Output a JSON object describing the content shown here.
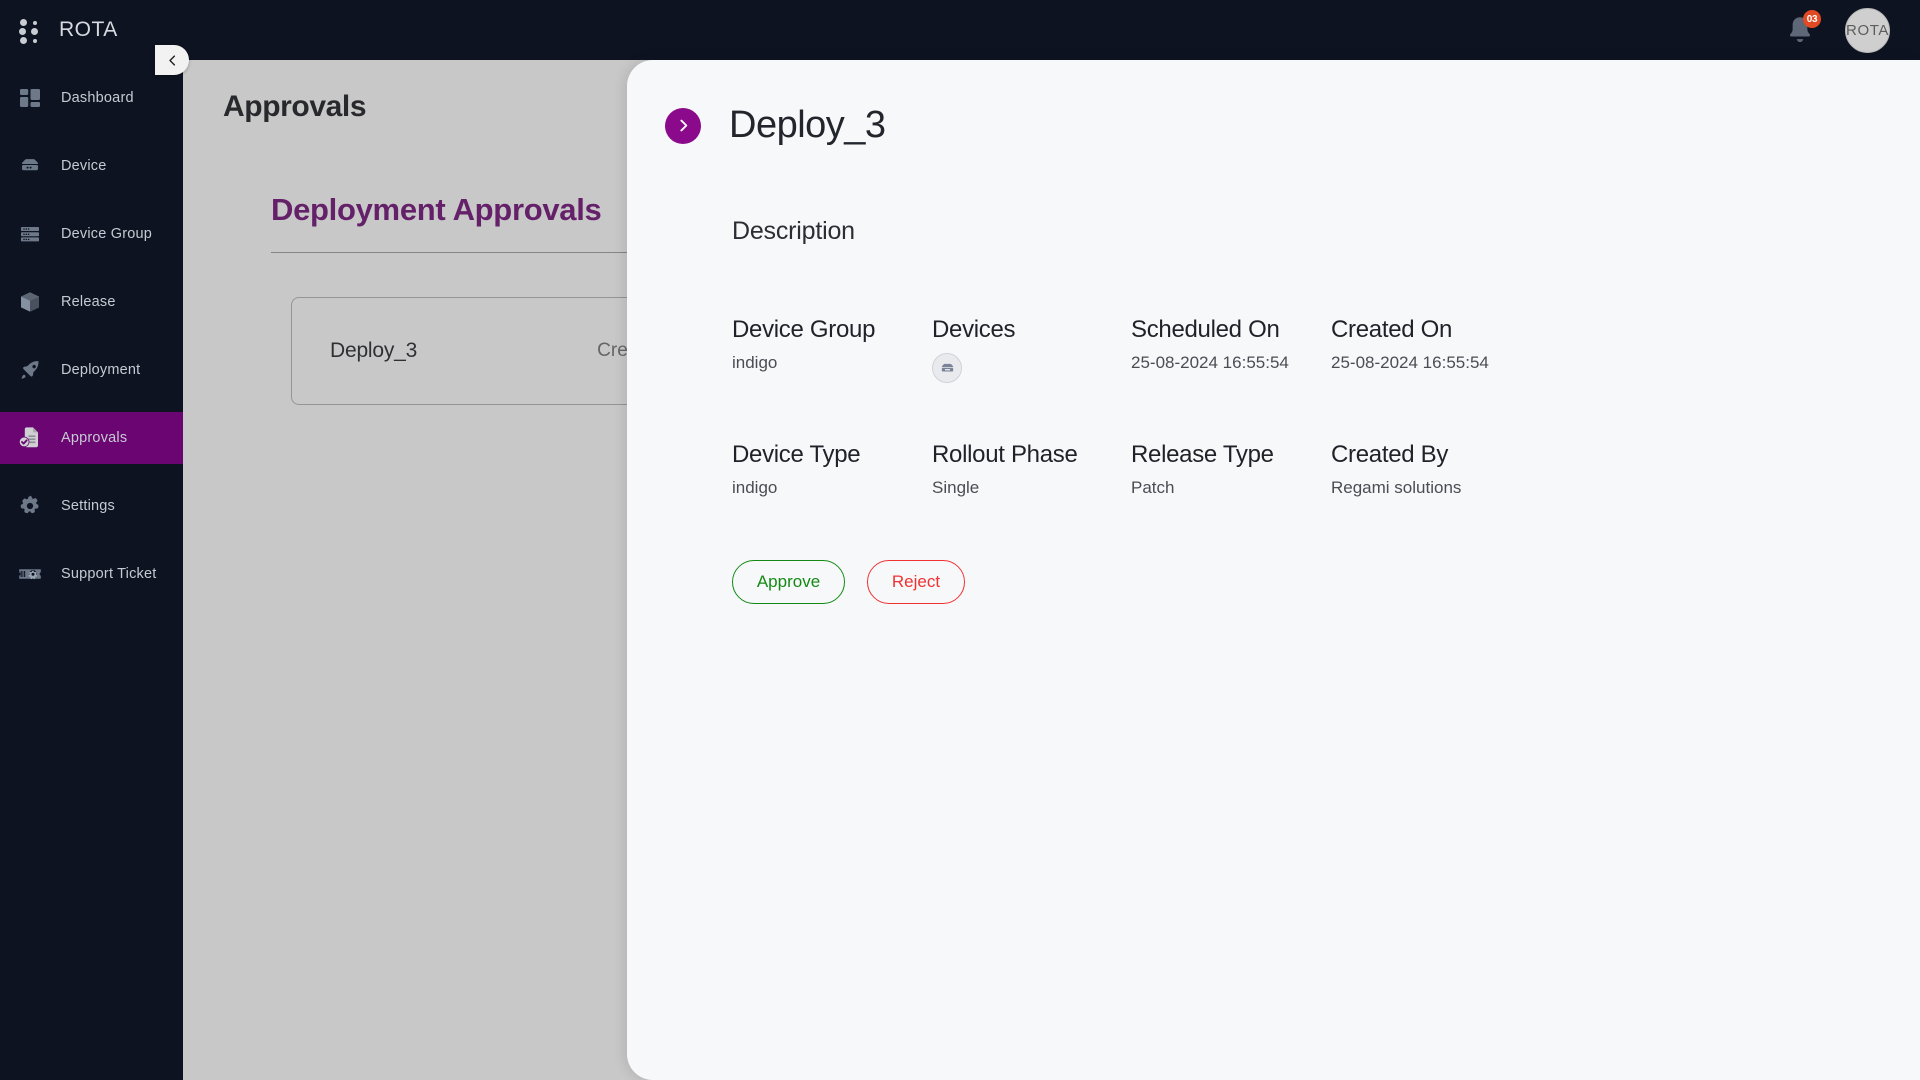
{
  "topbar": {
    "brand": "ROTA",
    "menu_icon": "grid-dots-icon",
    "notification_icon": "bell-icon",
    "notification_count": "03",
    "avatar_text": "ROTA"
  },
  "sidebar": {
    "collapse_icon": "chevron-left-icon",
    "items": [
      {
        "label": "Dashboard",
        "icon": "dashboard-icon",
        "active": false
      },
      {
        "label": "Device",
        "icon": "device-icon",
        "active": false
      },
      {
        "label": "Device Group",
        "icon": "device-group-icon",
        "active": false
      },
      {
        "label": "Release",
        "icon": "package-icon",
        "active": false
      },
      {
        "label": "Deployment",
        "icon": "rocket-icon",
        "active": false
      },
      {
        "label": "Approvals",
        "icon": "approvals-icon",
        "active": true
      },
      {
        "label": "Settings",
        "icon": "gear-icon",
        "active": false
      },
      {
        "label": "Support Ticket",
        "icon": "ticket-icon",
        "active": false
      }
    ]
  },
  "main": {
    "page_title": "Approvals",
    "section_title": "Deployment Approvals",
    "card": {
      "name": "Deploy_3",
      "meta": "Created By"
    }
  },
  "panel": {
    "close_icon": "chevron-right-icon",
    "title": "Deploy_3",
    "description_label": "Description",
    "fields": [
      {
        "label": "Device Group",
        "value": "indigo"
      },
      {
        "label": "Devices",
        "value": "",
        "icon": "device-avatar-icon"
      },
      {
        "label": "Scheduled On",
        "value": "25-08-2024 16:55:54"
      },
      {
        "label": "Created On",
        "value": "25-08-2024 16:55:54"
      },
      {
        "label": "Device Type",
        "value": "indigo"
      },
      {
        "label": "Rollout Phase",
        "value": "Single"
      },
      {
        "label": "Release Type",
        "value": "Patch"
      },
      {
        "label": "Created By",
        "value": "Regami solutions"
      }
    ],
    "approve_label": "Approve",
    "reject_label": "Reject"
  },
  "colors": {
    "brand_purple": "#6a0572",
    "panel_close_purple": "#8b0a8b",
    "sidebar_bg": "#0d1320",
    "approve_green": "#148a14",
    "reject_red": "#f03232",
    "badge_orange": "#e14a22"
  }
}
